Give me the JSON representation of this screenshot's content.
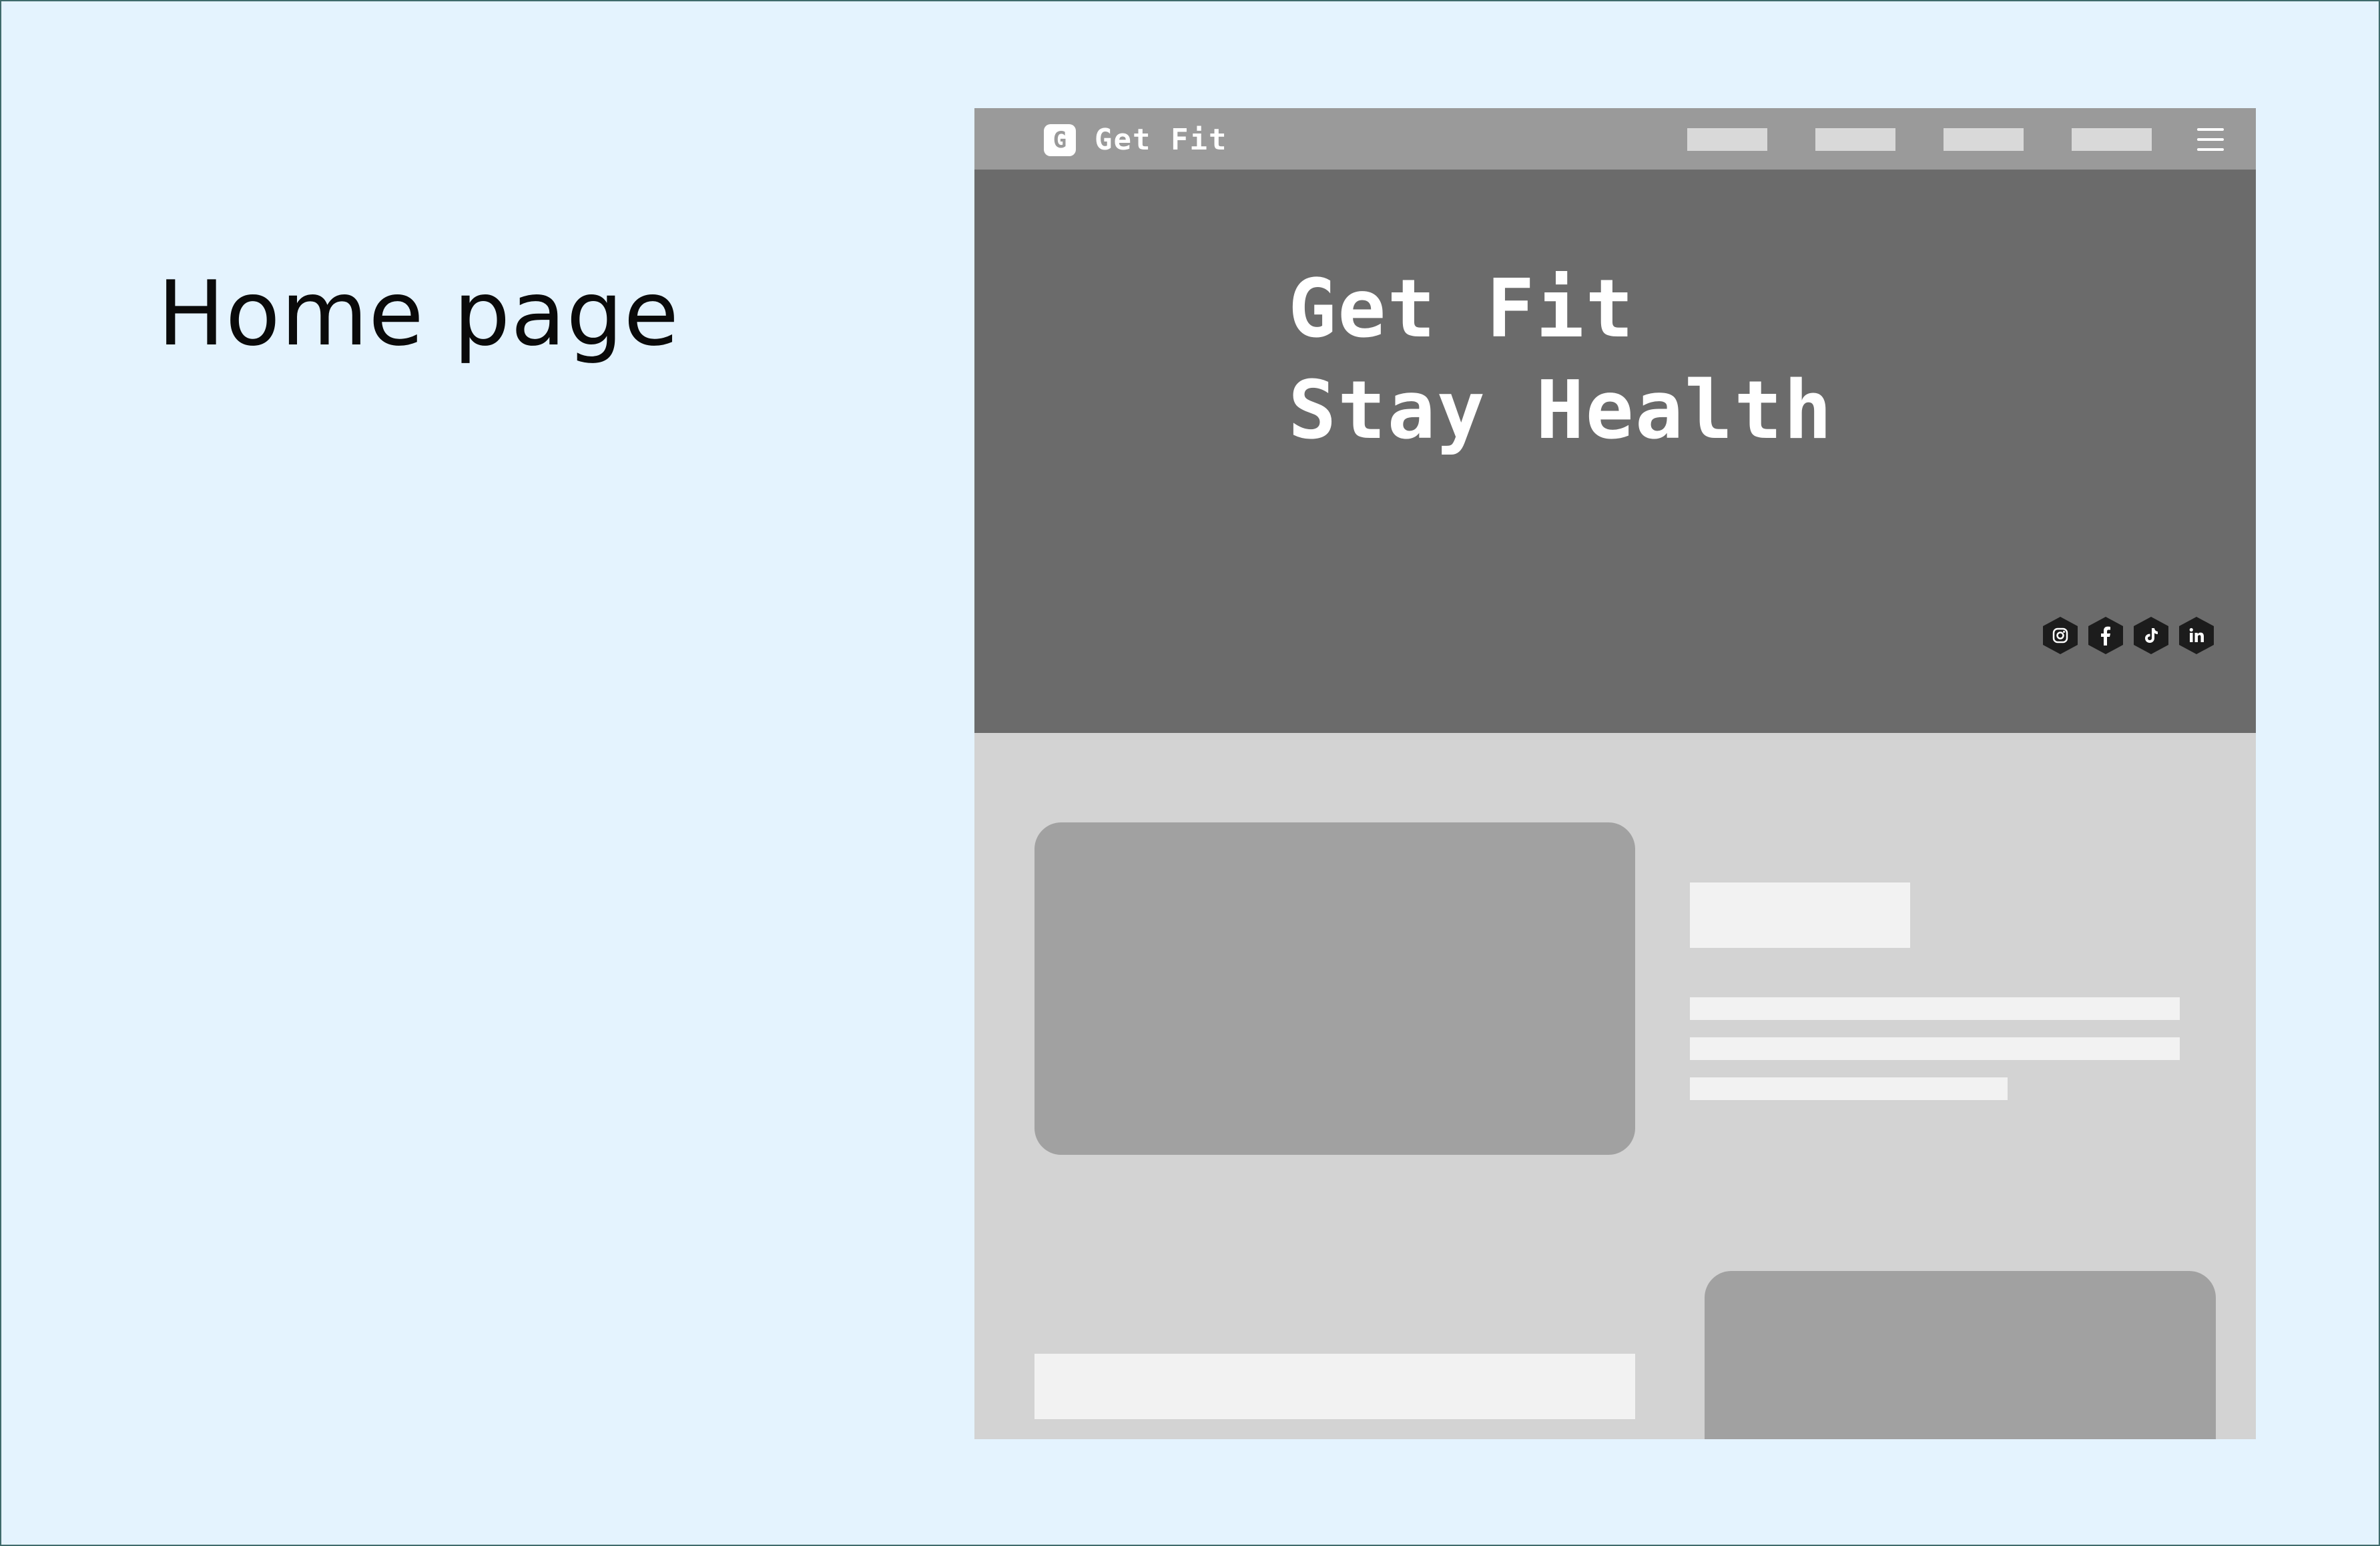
{
  "page_label": "Home page",
  "navbar": {
    "logo_glyph": "G",
    "brand": "Get Fit",
    "menu_icon": "hamburger-icon"
  },
  "hero": {
    "line1": "Get Fit",
    "line2": "Stay Health",
    "social_icons": [
      "instagram-icon",
      "facebook-icon",
      "tiktok-icon",
      "linkedin-icon"
    ]
  },
  "colors": {
    "background": "#e4f3fe",
    "navbar": "#9a9a9a",
    "hero": "#6b6b6b",
    "content": "#d3d3d3",
    "placeholder_image": "#a1a1a1",
    "placeholder_text": "#f2f2f2"
  }
}
